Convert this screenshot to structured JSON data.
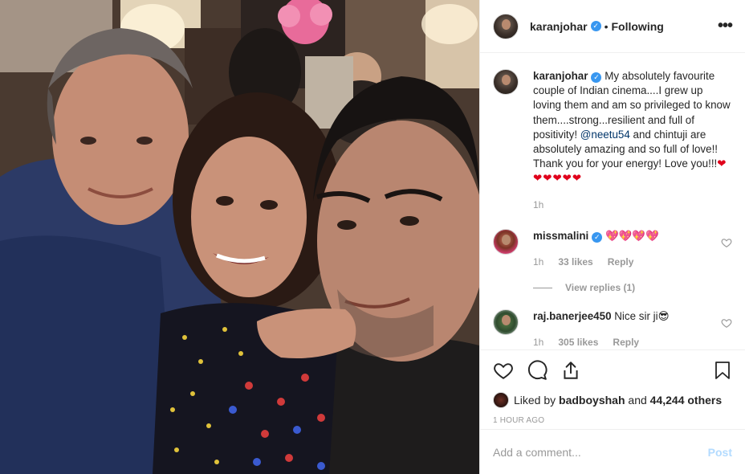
{
  "header": {
    "username": "karanjohar",
    "separator": "•",
    "following_label": "Following",
    "more_label": "•••"
  },
  "caption": {
    "username": "karanjohar",
    "text_before_mention": "My absolutely favourite couple of Indian cinema....I grew up loving them and am so privileged to know them....strong...resilient and full of positivity! ",
    "mention": "@neetu54",
    "text_after_mention": " and chintuji are absolutely amazing and so full of love!! Thank you for your energy! Love you!!!",
    "hearts": "❤❤❤❤❤❤",
    "time": "1h"
  },
  "comments": [
    {
      "username": "missmalini",
      "text": "💖💖💖💖",
      "time": "1h",
      "likes": "33 likes",
      "reply_label": "Reply",
      "view_replies": "View replies (1)"
    },
    {
      "username": "raj.banerjee450",
      "text": "Nice sir ji😎",
      "time": "1h",
      "likes": "305 likes",
      "reply_label": "Reply"
    }
  ],
  "likes": {
    "prefix": "Liked by ",
    "user": "badboyshah",
    "middle": " and ",
    "count": "44,244 others"
  },
  "timestamp": "1 HOUR AGO",
  "add_comment": {
    "placeholder": "Add a comment...",
    "post_label": "Post"
  },
  "icons": {
    "verified": "verified-badge-icon",
    "like": "heart-icon",
    "comment": "speech-bubble-icon",
    "share": "share-icon",
    "save": "bookmark-icon",
    "more": "more-options-icon"
  },
  "colors": {
    "verified_blue": "#3897f0",
    "heart_red": "#e0001b",
    "post_button_disabled": "#b3dbff",
    "mention": "#003569"
  }
}
